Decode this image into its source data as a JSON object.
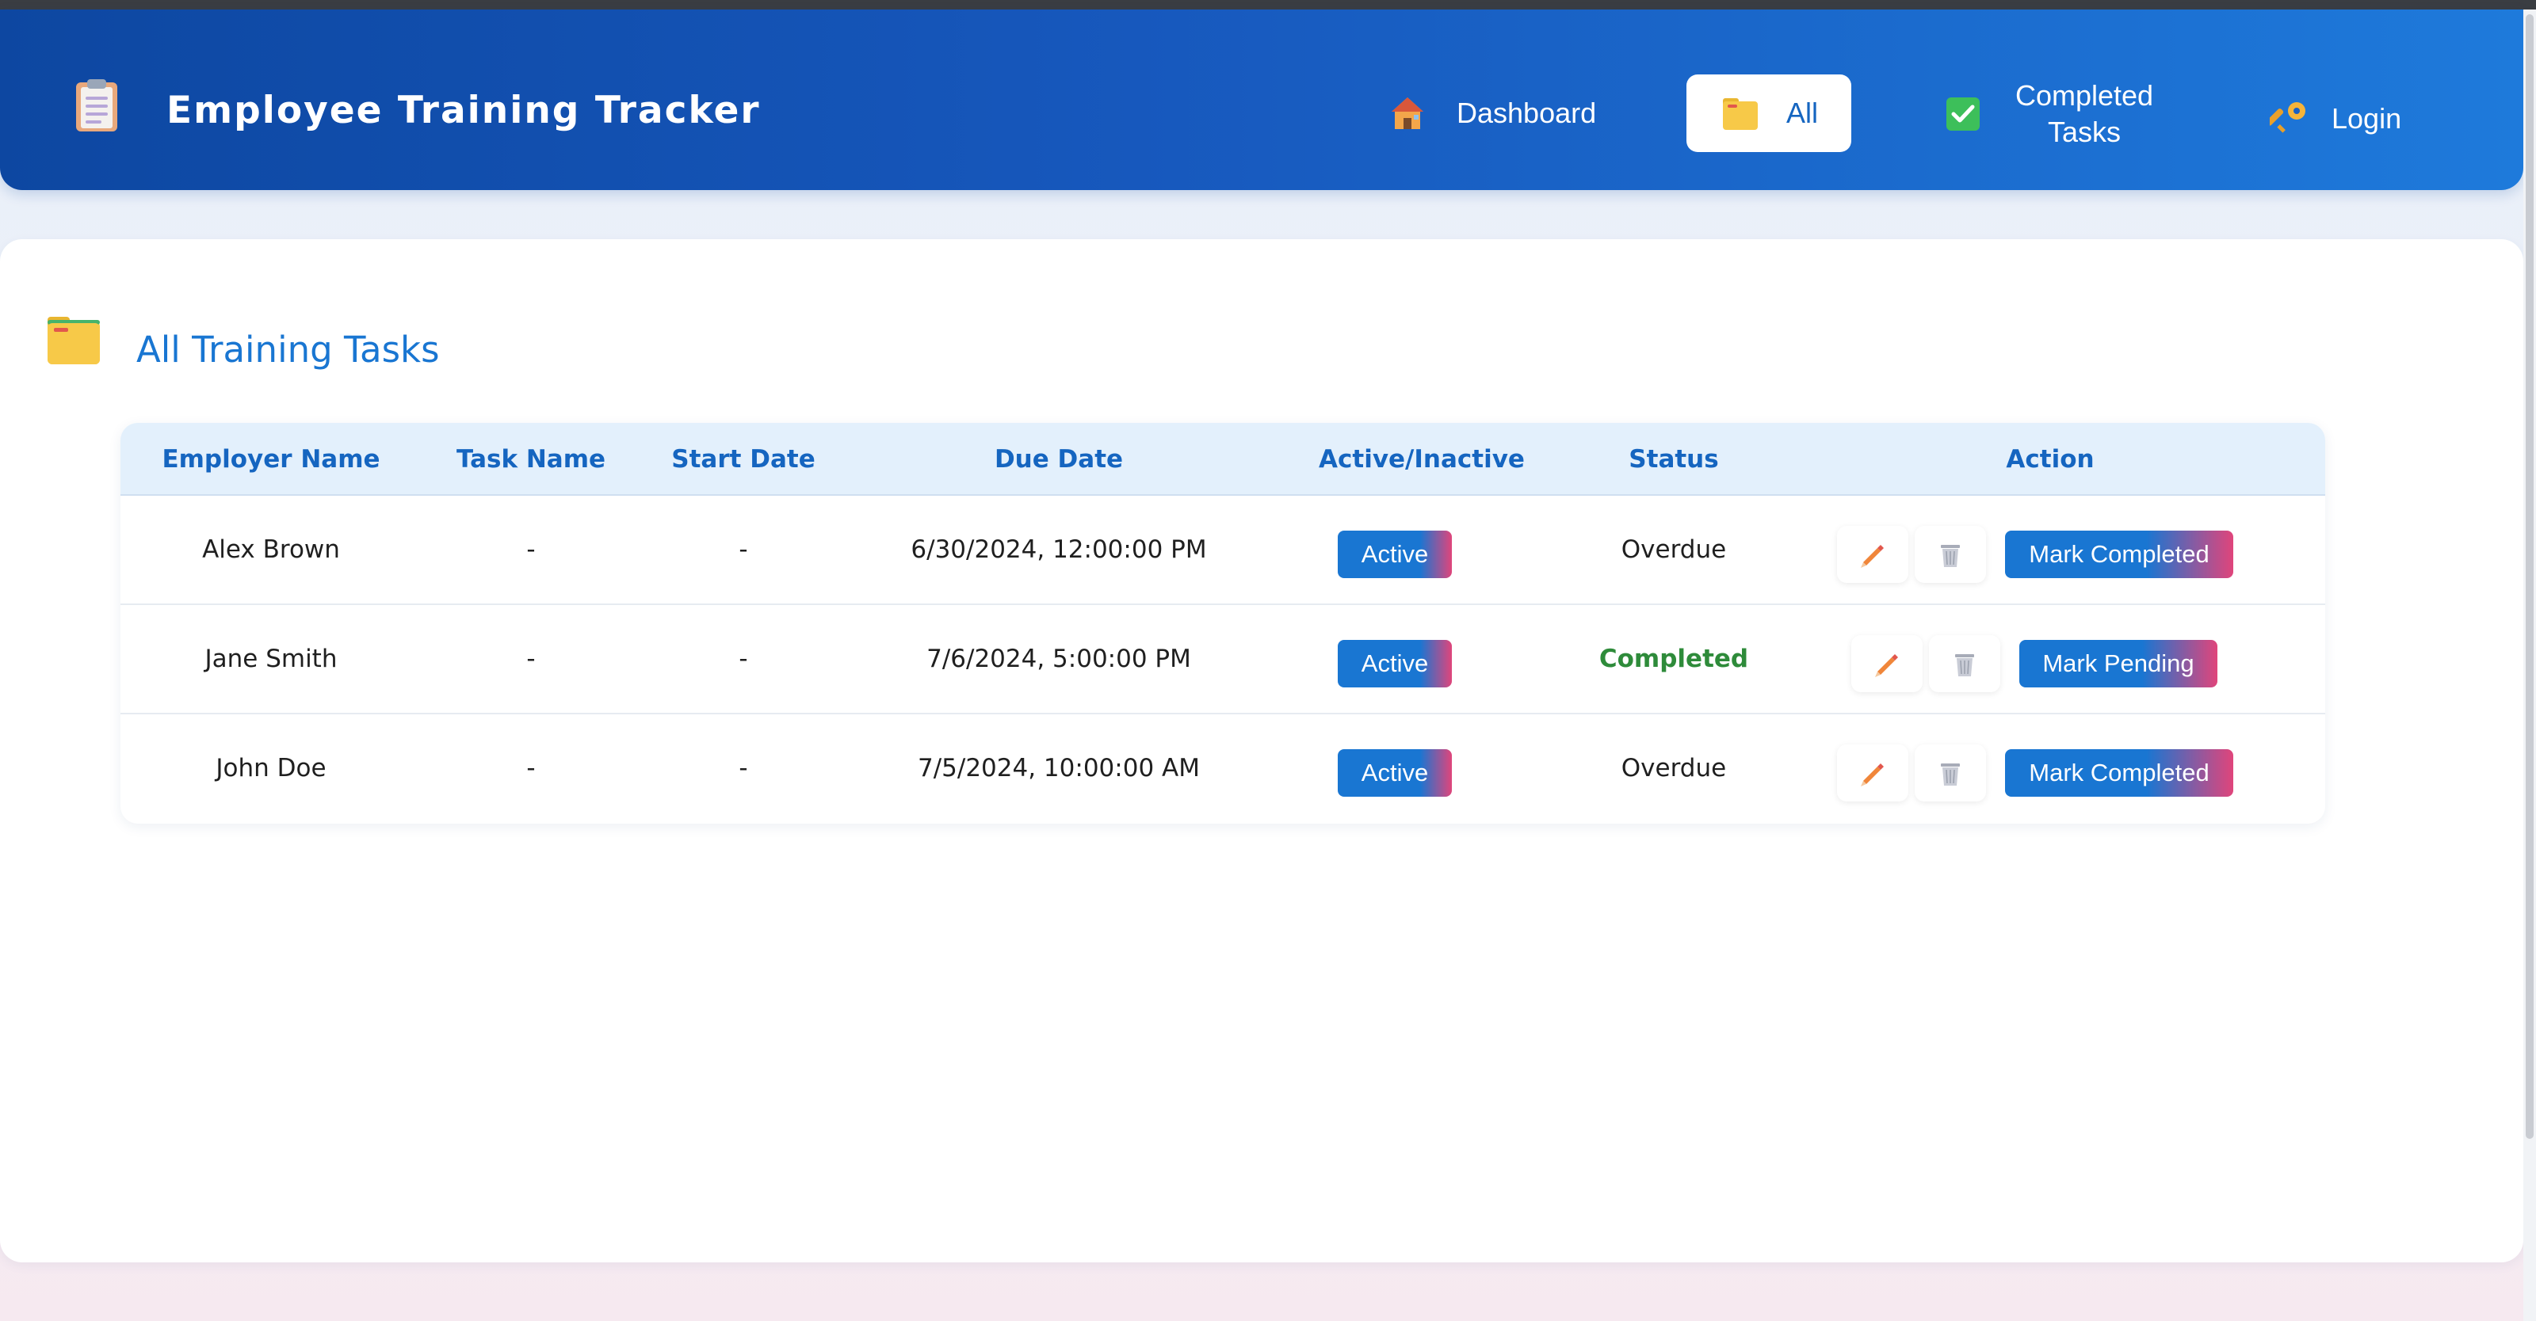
{
  "app": {
    "title": "Employee Training Tracker",
    "brand_icon": "clipboard-icon"
  },
  "nav": {
    "items": [
      {
        "label": "Dashboard",
        "icon": "house-icon",
        "active": false
      },
      {
        "label": "All",
        "icon": "folder-icon",
        "active": true
      },
      {
        "label": "Completed\nTasks",
        "icon": "check-box-icon",
        "active": false
      },
      {
        "label": "Login",
        "icon": "key-icon",
        "active": false
      }
    ]
  },
  "main": {
    "section_title": "All Training Tasks",
    "section_icon": "folder-icon"
  },
  "table": {
    "headers": [
      "Employer Name",
      "Task Name",
      "Start Date",
      "Due Date",
      "Active/Inactive",
      "Status",
      "Action"
    ],
    "rows": [
      {
        "employer": "Alex Brown",
        "task": "-",
        "start": "-",
        "due": "6/30/2024, 12:00:00 PM",
        "active": "Active",
        "status": "Overdue",
        "action": "Mark Completed"
      },
      {
        "employer": "Jane Smith",
        "task": "-",
        "start": "-",
        "due": "7/6/2024, 5:00:00 PM",
        "active": "Active",
        "status": "Completed",
        "action": "Mark Pending"
      },
      {
        "employer": "John Doe",
        "task": "-",
        "start": "-",
        "due": "7/5/2024, 10:00:00 AM",
        "active": "Active",
        "status": "Overdue",
        "action": "Mark Completed"
      }
    ]
  },
  "colors": {
    "header_gradient_start": "#0d47a1",
    "header_gradient_end": "#1e7adb",
    "accent": "#1976d2",
    "accent_pink": "#e0457b",
    "completed_text": "#2e8b3a"
  }
}
